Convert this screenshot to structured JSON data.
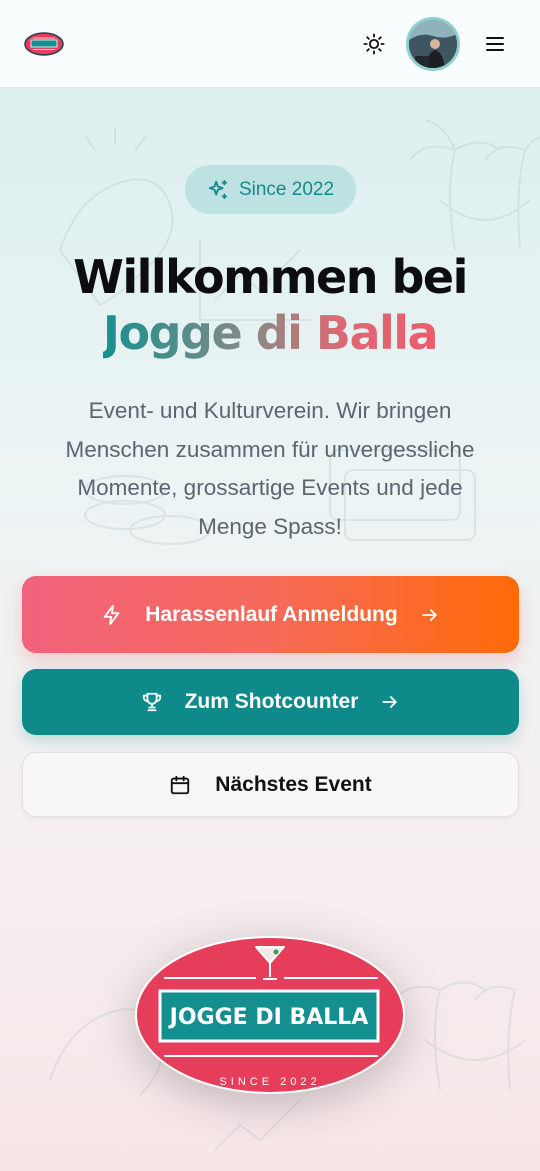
{
  "header": {
    "logo_alt": "Jogge di Balla",
    "icons": {
      "theme": "sun-icon",
      "menu": "hamburger-menu-icon"
    }
  },
  "hero": {
    "badge": {
      "icon": "sparkles-icon",
      "label": "Since 2022"
    },
    "title_line1": "Willkommen bei",
    "title_line2": "Jogge di Balla",
    "description": "Event- und Kulturverein. Wir bringen Menschen zusammen für unvergessliche Momente, grossartige Events und jede Menge Spass!"
  },
  "actions": {
    "harassenlauf": {
      "icon": "lightning-icon",
      "label": "Harassenlauf Anmeldung",
      "arrow": "arrow-right-icon"
    },
    "shotcounter": {
      "icon": "trophy-icon",
      "label": "Zum Shotcounter",
      "arrow": "arrow-right-icon"
    },
    "next_event": {
      "icon": "calendar-icon",
      "label": "Nächstes Event"
    }
  },
  "logo": {
    "name": "JOGGE DI BALLA",
    "since": "SINCE 2022"
  },
  "colors": {
    "teal": "#0f8a8a",
    "coral": "#f1627c",
    "orange": "#ff6a08",
    "logo_red": "#e63e5a"
  }
}
